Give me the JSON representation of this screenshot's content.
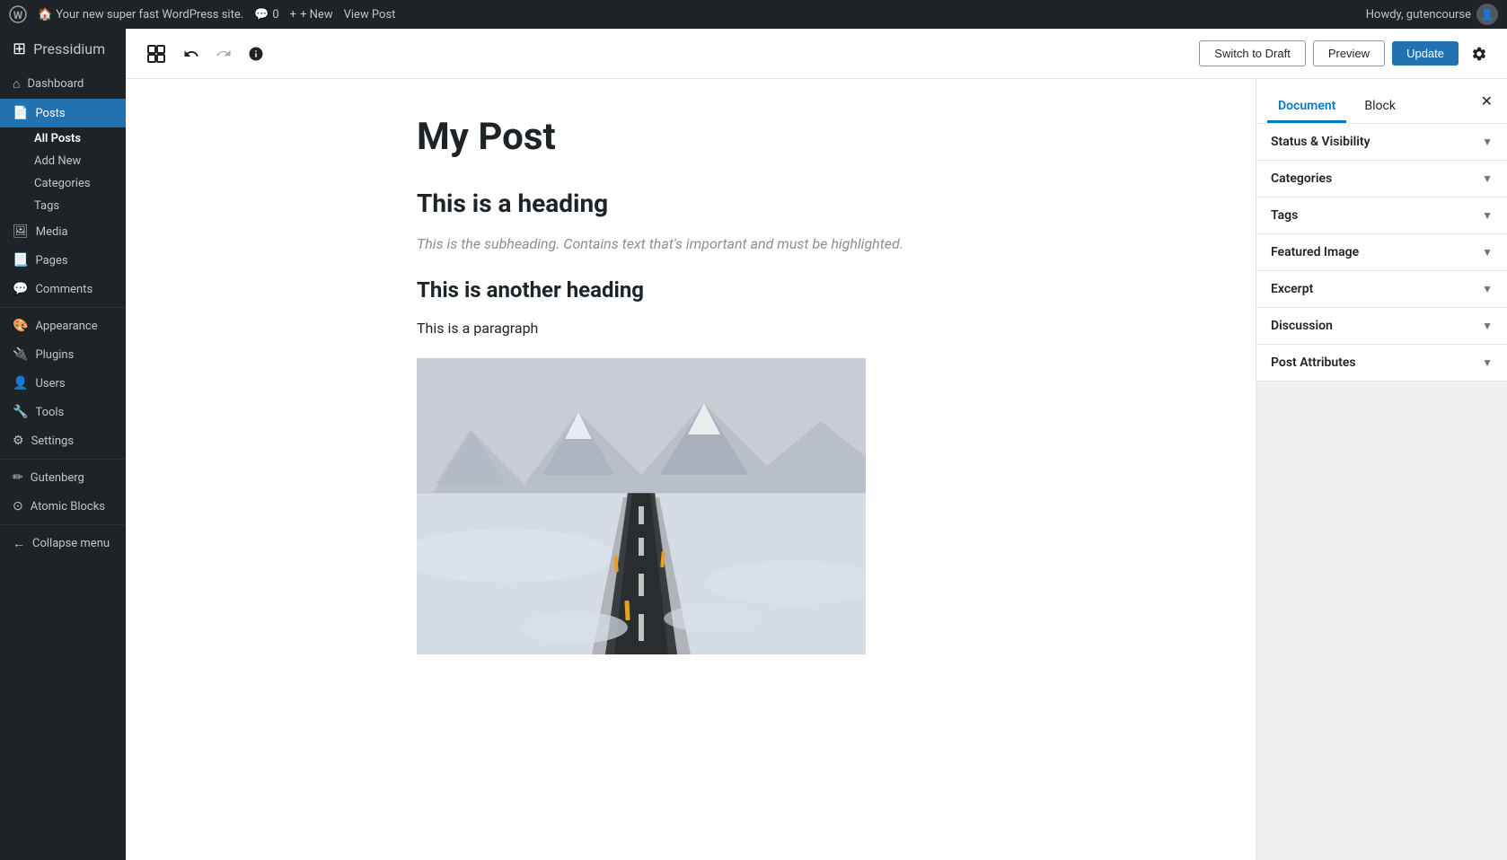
{
  "admin_bar": {
    "wp_logo": "W",
    "site_icon": "🏠",
    "site_name": "Your new super fast WordPress site.",
    "comments_label": "💬",
    "comments_count": "0",
    "new_label": "+ New",
    "view_post": "View Post",
    "howdy": "Howdy, gutencourse",
    "user_avatar": "👤"
  },
  "sidebar": {
    "brand_icon": "⊞",
    "brand_name": "Pressidium",
    "items": [
      {
        "id": "dashboard",
        "icon": "⌂",
        "label": "Dashboard"
      },
      {
        "id": "posts",
        "icon": "📄",
        "label": "Posts",
        "active": true
      },
      {
        "id": "all-posts",
        "label": "All Posts",
        "sub": true,
        "active": true
      },
      {
        "id": "add-new",
        "label": "Add New",
        "sub": true
      },
      {
        "id": "categories",
        "label": "Categories",
        "sub": true
      },
      {
        "id": "tags",
        "label": "Tags",
        "sub": true
      },
      {
        "id": "media",
        "icon": "🖼",
        "label": "Media"
      },
      {
        "id": "pages",
        "icon": "📃",
        "label": "Pages"
      },
      {
        "id": "comments",
        "icon": "💬",
        "label": "Comments"
      },
      {
        "id": "appearance",
        "icon": "🎨",
        "label": "Appearance"
      },
      {
        "id": "plugins",
        "icon": "🔌",
        "label": "Plugins"
      },
      {
        "id": "users",
        "icon": "👤",
        "label": "Users"
      },
      {
        "id": "tools",
        "icon": "🔧",
        "label": "Tools"
      },
      {
        "id": "settings",
        "icon": "⚙",
        "label": "Settings"
      },
      {
        "id": "gutenberg",
        "icon": "✏",
        "label": "Gutenberg"
      },
      {
        "id": "atomic-blocks",
        "icon": "⊙",
        "label": "Atomic Blocks"
      },
      {
        "id": "collapse-menu",
        "icon": "←",
        "label": "Collapse menu"
      }
    ]
  },
  "toolbar": {
    "add_block_title": "Add block",
    "undo_title": "Undo",
    "redo_title": "Redo",
    "info_title": "View post details",
    "switch_draft_label": "Switch to Draft",
    "preview_label": "Preview",
    "update_label": "Update",
    "settings_title": "Settings"
  },
  "document": {
    "post_title": "My Post",
    "heading1": "This is a heading",
    "subheading": "This is the subheading. Contains text that's important and must be highlighted.",
    "heading2": "This is another heading",
    "paragraph": "This is a paragraph"
  },
  "right_panel": {
    "doc_tab": "Document",
    "block_tab": "Block",
    "sections": [
      {
        "id": "status-visibility",
        "label": "Status & Visibility"
      },
      {
        "id": "categories",
        "label": "Categories"
      },
      {
        "id": "tags",
        "label": "Tags"
      },
      {
        "id": "featured-image",
        "label": "Featured Image"
      },
      {
        "id": "excerpt",
        "label": "Excerpt"
      },
      {
        "id": "discussion",
        "label": "Discussion"
      },
      {
        "id": "post-attributes",
        "label": "Post Attributes"
      }
    ]
  }
}
